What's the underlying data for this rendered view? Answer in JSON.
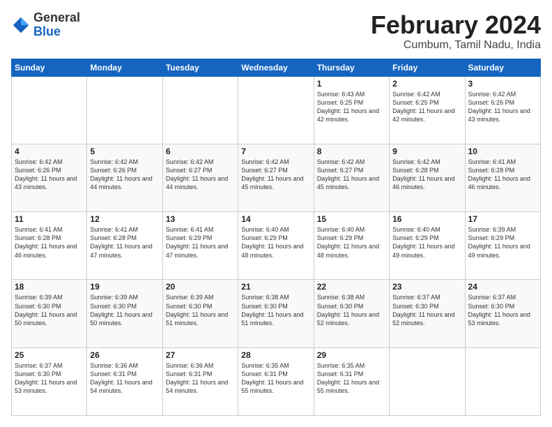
{
  "header": {
    "logo_general": "General",
    "logo_blue": "Blue",
    "title": "February 2024",
    "location": "Cumbum, Tamil Nadu, India"
  },
  "days_of_week": [
    "Sunday",
    "Monday",
    "Tuesday",
    "Wednesday",
    "Thursday",
    "Friday",
    "Saturday"
  ],
  "weeks": [
    [
      {
        "day": "",
        "info": ""
      },
      {
        "day": "",
        "info": ""
      },
      {
        "day": "",
        "info": ""
      },
      {
        "day": "",
        "info": ""
      },
      {
        "day": "1",
        "info": "Sunrise: 6:43 AM\nSunset: 6:25 PM\nDaylight: 11 hours\nand 42 minutes."
      },
      {
        "day": "2",
        "info": "Sunrise: 6:42 AM\nSunset: 6:25 PM\nDaylight: 11 hours\nand 42 minutes."
      },
      {
        "day": "3",
        "info": "Sunrise: 6:42 AM\nSunset: 6:26 PM\nDaylight: 11 hours\nand 43 minutes."
      }
    ],
    [
      {
        "day": "4",
        "info": "Sunrise: 6:42 AM\nSunset: 6:26 PM\nDaylight: 11 hours\nand 43 minutes."
      },
      {
        "day": "5",
        "info": "Sunrise: 6:42 AM\nSunset: 6:26 PM\nDaylight: 11 hours\nand 44 minutes."
      },
      {
        "day": "6",
        "info": "Sunrise: 6:42 AM\nSunset: 6:27 PM\nDaylight: 11 hours\nand 44 minutes."
      },
      {
        "day": "7",
        "info": "Sunrise: 6:42 AM\nSunset: 6:27 PM\nDaylight: 11 hours\nand 45 minutes."
      },
      {
        "day": "8",
        "info": "Sunrise: 6:42 AM\nSunset: 6:27 PM\nDaylight: 11 hours\nand 45 minutes."
      },
      {
        "day": "9",
        "info": "Sunrise: 6:42 AM\nSunset: 6:28 PM\nDaylight: 11 hours\nand 46 minutes."
      },
      {
        "day": "10",
        "info": "Sunrise: 6:41 AM\nSunset: 6:28 PM\nDaylight: 11 hours\nand 46 minutes."
      }
    ],
    [
      {
        "day": "11",
        "info": "Sunrise: 6:41 AM\nSunset: 6:28 PM\nDaylight: 11 hours\nand 46 minutes."
      },
      {
        "day": "12",
        "info": "Sunrise: 6:41 AM\nSunset: 6:28 PM\nDaylight: 11 hours\nand 47 minutes."
      },
      {
        "day": "13",
        "info": "Sunrise: 6:41 AM\nSunset: 6:29 PM\nDaylight: 11 hours\nand 47 minutes."
      },
      {
        "day": "14",
        "info": "Sunrise: 6:40 AM\nSunset: 6:29 PM\nDaylight: 11 hours\nand 48 minutes."
      },
      {
        "day": "15",
        "info": "Sunrise: 6:40 AM\nSunset: 6:29 PM\nDaylight: 11 hours\nand 48 minutes."
      },
      {
        "day": "16",
        "info": "Sunrise: 6:40 AM\nSunset: 6:29 PM\nDaylight: 11 hours\nand 49 minutes."
      },
      {
        "day": "17",
        "info": "Sunrise: 6:39 AM\nSunset: 6:29 PM\nDaylight: 11 hours\nand 49 minutes."
      }
    ],
    [
      {
        "day": "18",
        "info": "Sunrise: 6:39 AM\nSunset: 6:30 PM\nDaylight: 11 hours\nand 50 minutes."
      },
      {
        "day": "19",
        "info": "Sunrise: 6:39 AM\nSunset: 6:30 PM\nDaylight: 11 hours\nand 50 minutes."
      },
      {
        "day": "20",
        "info": "Sunrise: 6:39 AM\nSunset: 6:30 PM\nDaylight: 11 hours\nand 51 minutes."
      },
      {
        "day": "21",
        "info": "Sunrise: 6:38 AM\nSunset: 6:30 PM\nDaylight: 11 hours\nand 51 minutes."
      },
      {
        "day": "22",
        "info": "Sunrise: 6:38 AM\nSunset: 6:30 PM\nDaylight: 11 hours\nand 52 minutes."
      },
      {
        "day": "23",
        "info": "Sunrise: 6:37 AM\nSunset: 6:30 PM\nDaylight: 11 hours\nand 52 minutes."
      },
      {
        "day": "24",
        "info": "Sunrise: 6:37 AM\nSunset: 6:30 PM\nDaylight: 11 hours\nand 53 minutes."
      }
    ],
    [
      {
        "day": "25",
        "info": "Sunrise: 6:37 AM\nSunset: 6:30 PM\nDaylight: 11 hours\nand 53 minutes."
      },
      {
        "day": "26",
        "info": "Sunrise: 6:36 AM\nSunset: 6:31 PM\nDaylight: 11 hours\nand 54 minutes."
      },
      {
        "day": "27",
        "info": "Sunrise: 6:36 AM\nSunset: 6:31 PM\nDaylight: 11 hours\nand 54 minutes."
      },
      {
        "day": "28",
        "info": "Sunrise: 6:35 AM\nSunset: 6:31 PM\nDaylight: 11 hours\nand 55 minutes."
      },
      {
        "day": "29",
        "info": "Sunrise: 6:35 AM\nSunset: 6:31 PM\nDaylight: 11 hours\nand 55 minutes."
      },
      {
        "day": "",
        "info": ""
      },
      {
        "day": "",
        "info": ""
      }
    ]
  ]
}
